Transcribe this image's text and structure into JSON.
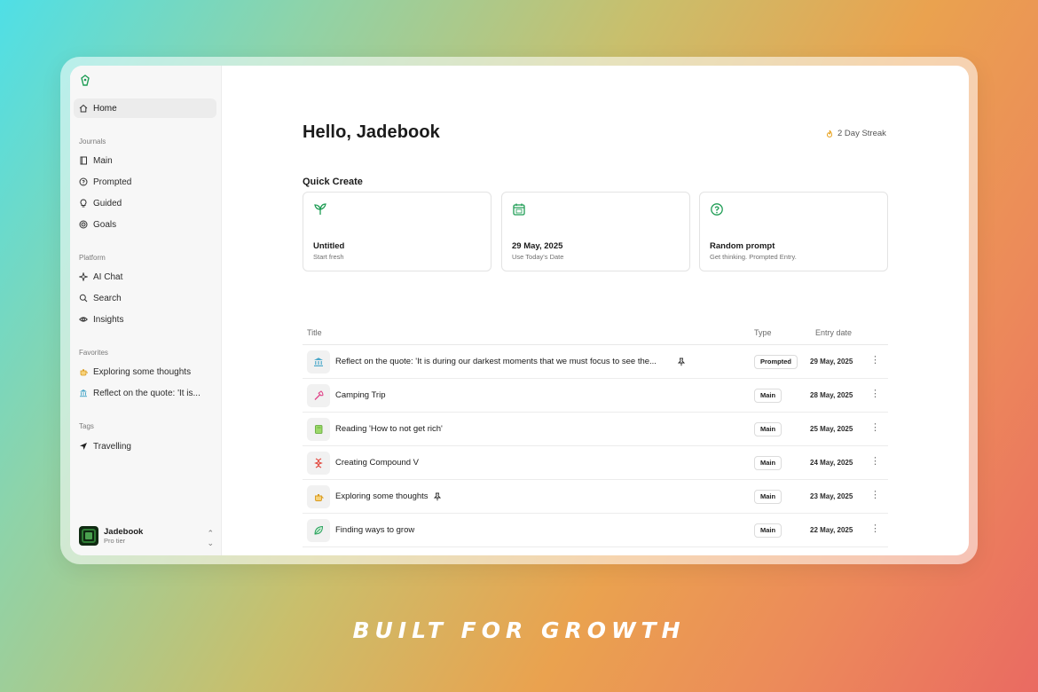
{
  "sidebar": {
    "home": {
      "label": "Home",
      "icon": "home-icon"
    },
    "journals": {
      "label": "Journals",
      "items": [
        {
          "label": "Main",
          "icon": "book-icon"
        },
        {
          "label": "Prompted",
          "icon": "help-circle-icon"
        },
        {
          "label": "Guided",
          "icon": "lightbulb-icon"
        },
        {
          "label": "Goals",
          "icon": "target-icon"
        }
      ]
    },
    "platform": {
      "label": "Platform",
      "items": [
        {
          "label": "AI Chat",
          "icon": "sparkle-icon"
        },
        {
          "label": "Search",
          "icon": "search-icon"
        },
        {
          "label": "Insights",
          "icon": "eye-icon"
        }
      ]
    },
    "favorites": {
      "label": "Favorites",
      "items": [
        {
          "label": "Exploring some thoughts",
          "icon": "teapot-icon"
        },
        {
          "label": "Reflect on the quote: 'It is...",
          "icon": "bank-icon"
        }
      ]
    },
    "tags": {
      "label": "Tags",
      "items": [
        {
          "label": "Travelling",
          "icon": "plane-icon"
        }
      ]
    },
    "user": {
      "name": "Jadebook",
      "tier": "Pro tier"
    }
  },
  "main": {
    "greeting": "Hello, Jadebook",
    "streak": "2 Day Streak",
    "quick_create": {
      "title": "Quick Create",
      "cards": [
        {
          "title": "Untitled",
          "subtitle": "Start fresh",
          "icon": "sprout-icon"
        },
        {
          "title": "29 May, 2025",
          "subtitle": "Use Today's Date",
          "icon": "calendar-icon"
        },
        {
          "title": "Random prompt",
          "subtitle": "Get thinking. Prompted Entry.",
          "icon": "question-icon"
        }
      ]
    },
    "table": {
      "headers": {
        "title": "Title",
        "type": "Type",
        "date": "Entry date"
      },
      "rows": [
        {
          "title": "Reflect on the quote: 'It is during our darkest moments that we must focus to see the...",
          "type": "Prompted",
          "date": "29 May, 2025",
          "icon": "bank-icon",
          "pinned": true
        },
        {
          "title": "Camping Trip",
          "type": "Main",
          "date": "28 May, 2025",
          "icon": "axe-icon",
          "pinned": false
        },
        {
          "title": "Reading 'How to not get rich'",
          "type": "Main",
          "date": "25 May, 2025",
          "icon": "book-green-icon",
          "pinned": false
        },
        {
          "title": "Creating Compound V",
          "type": "Main",
          "date": "24 May, 2025",
          "icon": "dna-icon",
          "pinned": false
        },
        {
          "title": "Exploring some thoughts",
          "type": "Main",
          "date": "23 May, 2025",
          "icon": "teapot-icon",
          "pinned": true
        },
        {
          "title": "Finding ways to grow",
          "type": "Main",
          "date": "22 May, 2025",
          "icon": "leaf-icon",
          "pinned": false
        }
      ]
    }
  },
  "tagline": "BUILT FOR GROWTH",
  "colors": {
    "accent_green": "#1f9d55",
    "streak_orange": "#e8a21f"
  }
}
